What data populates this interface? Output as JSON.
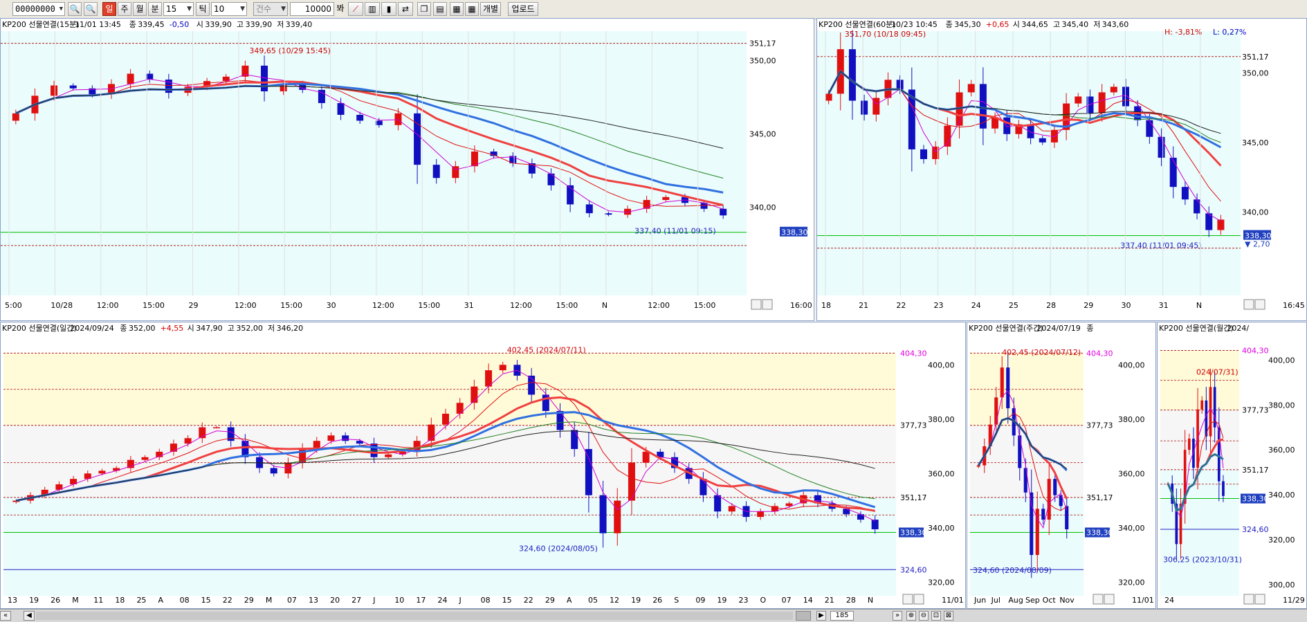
{
  "toolbar": {
    "code": "00000000",
    "buttons": [
      "일",
      "주",
      "월",
      "분"
    ],
    "active": "일",
    "interval": "15",
    "tick_label": "틱",
    "tick_value": "10",
    "count_label": "건수",
    "count_value": "10000",
    "bar_label": "봐",
    "individual": "개별",
    "upload": "업로드"
  },
  "panels": [
    {
      "id": "p15",
      "header": {
        "name": "KP200 선물연결(15분)",
        "date": "11/01 13:45",
        "close_label": "종",
        "close": "339,45",
        "change": "-0,50",
        "open_label": "시",
        "open": "339,90",
        "high_label": "고",
        "high": "339,90",
        "low_label": "저",
        "low": "339,40"
      },
      "right_labels": [
        "351,17",
        "350,00",
        "345,00",
        "340,00"
      ],
      "price_tag": "338,30",
      "time_end": "16:00",
      "annotations": [
        "349,65 (10/29 15:45)",
        "337,40 (11/01 09:15)"
      ],
      "x_labels": [
        "5:00",
        "10/28",
        "12:00",
        "15:00",
        "29",
        "12:00",
        "15:00",
        "30",
        "12:00",
        "15:00",
        "31",
        "12:00",
        "15:00",
        "N",
        "12:00",
        "15:00"
      ]
    },
    {
      "id": "p60",
      "header": {
        "name": "KP200 선물연결(60분)",
        "date": "10/23 10:45",
        "close_label": "종",
        "close": "345,30",
        "change": "+0,65",
        "open_label": "시",
        "open": "344,65",
        "high_label": "고",
        "high": "345,40",
        "low_label": "저",
        "low": "343,60"
      },
      "hl": {
        "h": "H: -3,81%",
        "l": "L: 0,27%"
      },
      "right_labels": [
        "351,17",
        "350,00",
        "345,00",
        "340,00"
      ],
      "price_tag": "338,30",
      "diff": "2,70",
      "time_end": "16:45",
      "annotations": [
        "351,70 (10/18 09:45)",
        "337,40 (11/01 09:45)"
      ],
      "x_labels": [
        "18",
        "21",
        "22",
        "23",
        "24",
        "25",
        "28",
        "29",
        "30",
        "31",
        "N"
      ]
    },
    {
      "id": "pday",
      "header": {
        "name": "KP200 선물연결(일간)",
        "date": "2024/09/24",
        "close_label": "종",
        "close": "352,00",
        "change": "+4,55",
        "open_label": "시",
        "open": "347,90",
        "high_label": "고",
        "high": "352,00",
        "low_label": "저",
        "low": "346,20"
      },
      "left_labels": [
        "404,30",
        "377,73",
        "351,17",
        "338,30",
        "324,60"
      ],
      "right_labels": [
        "400,00",
        "380,00",
        "360,00",
        "340,00",
        "320,00"
      ],
      "time_end": "11/01",
      "annotations": [
        "402,45 (2024/07/11)",
        "324,60 (2024/08/05)"
      ],
      "x_labels": [
        "13",
        "19",
        "26",
        "M",
        "11",
        "18",
        "25",
        "A",
        "08",
        "15",
        "22",
        "29",
        "M",
        "07",
        "13",
        "20",
        "27",
        "J",
        "10",
        "17",
        "24",
        "J",
        "08",
        "15",
        "22",
        "29",
        "A",
        "05",
        "12",
        "19",
        "26",
        "S",
        "09",
        "19",
        "23",
        "O",
        "07",
        "14",
        "21",
        "28",
        "N"
      ]
    },
    {
      "id": "pweek",
      "header": {
        "name": "KP200 선물연결(주간)",
        "date": "2024/07/19",
        "close_label": "종"
      },
      "left_labels": [
        "404,30",
        "377,73",
        "351,17",
        "338,30"
      ],
      "right_labels": [
        "400,00",
        "380,00",
        "360,00",
        "340,00",
        "320,00"
      ],
      "time_end": "11/01",
      "annotations": [
        "402,45 (2024/07/12)",
        "324,60 (2024/08/09)"
      ],
      "x_labels": [
        "Jun",
        "Jul",
        "Aug",
        "Sep",
        "Oct",
        "Nov"
      ]
    },
    {
      "id": "pmonth",
      "header": {
        "name": "KP200 선물연결(월간)",
        "date": "2024/"
      },
      "left_labels": [
        "404,30",
        "377,73",
        "351,17",
        "338,30",
        "324,60"
      ],
      "right_labels": [
        "400,00",
        "380,00",
        "360,00",
        "340,00",
        "320,00",
        "300,00"
      ],
      "time_end": "11/29",
      "annotations": [
        "024/07/31)",
        "306,25 (2023/10/31)"
      ],
      "x_labels": [
        "24"
      ]
    }
  ],
  "chart_data": [
    {
      "type": "candlestick",
      "title": "KP200 선물연결(15분)",
      "ylim": [
        334,
        352
      ],
      "reference_lines": {
        "351,17": 351.17,
        "338,30": 338.3
      },
      "series": [
        {
          "name": "KP200 선물연결(15분)",
          "close": [
            346.4,
            347.6,
            348.3,
            348.1,
            347.7,
            348.4,
            349.1,
            348.7,
            347.8,
            348.2,
            348.6,
            348.9,
            349.65,
            347.9,
            348.4,
            348.0,
            347.1,
            346.3,
            345.9,
            345.6,
            346.4,
            342.9,
            342.0,
            342.8,
            343.8,
            343.5,
            343.0,
            342.3,
            341.5,
            340.2,
            339.6,
            339.5,
            339.9,
            340.5,
            340.7,
            340.3,
            339.9,
            339.45
          ]
        }
      ]
    },
    {
      "type": "candlestick",
      "title": "KP200 선물연결(60분)",
      "ylim": [
        334,
        353
      ],
      "reference_lines": {
        "351,17": 351.17,
        "338,30": 338.3
      },
      "series": [
        {
          "name": "KP200 선물연결(60분)",
          "close": [
            348.5,
            351.7,
            348.0,
            347.0,
            348.2,
            349.5,
            348.8,
            344.5,
            343.8,
            344.7,
            346.2,
            348.6,
            349.2,
            346.0,
            346.8,
            345.6,
            346.3,
            345.3,
            345.0,
            345.9,
            347.8,
            348.3,
            347.1,
            348.6,
            349.0,
            347.6,
            346.6,
            345.4,
            343.9,
            341.8,
            340.9,
            339.9,
            338.7,
            339.45
          ]
        }
      ]
    },
    {
      "type": "candlestick",
      "title": "KP200 선물연결(일간)",
      "ylim": [
        315,
        410
      ],
      "reference_lines": {
        "404,30": 404.3,
        "377,73": 377.73,
        "351,17": 351.17,
        "338,30": 338.3,
        "324,60": 324.6
      },
      "series": [
        {
          "name": "KP200 선물연결(일간)",
          "close": [
            350,
            352,
            354,
            356,
            358,
            360,
            361,
            362,
            365,
            366,
            368,
            371,
            373,
            377,
            377,
            372,
            366,
            362,
            360,
            364,
            369,
            372,
            374,
            372,
            371,
            366,
            367,
            368,
            372,
            378,
            382,
            386,
            392,
            398,
            400,
            396,
            389,
            383,
            376,
            369,
            352,
            338,
            350,
            364,
            368,
            366,
            362,
            358,
            352,
            346,
            348,
            344,
            346,
            348,
            349,
            352,
            349,
            347,
            345,
            343,
            339.45
          ]
        }
      ]
    },
    {
      "type": "candlestick",
      "title": "KP200 선물연결(주간)",
      "ylim": [
        315,
        410
      ],
      "reference_lines": {
        "404,30": 404.3,
        "377,73": 377.73,
        "351,17": 351.17,
        "338,30": 338.3,
        "324,60": 324.6
      },
      "series": [
        {
          "name": "KP200 선물연결(주간)",
          "close": [
            363,
            370,
            378,
            388,
            399,
            384,
            374,
            362,
            353,
            330,
            347,
            343,
            358,
            352,
            348,
            339.45
          ]
        }
      ]
    },
    {
      "type": "candlestick",
      "title": "KP200 선물연결(월간)",
      "ylim": [
        295,
        410
      ],
      "reference_lines": {
        "404,30": 404.3,
        "377,73": 377.73,
        "351,17": 351.17,
        "338,30": 338.3,
        "324,60": 324.6
      },
      "series": [
        {
          "name": "KP200 선물연결(월간)",
          "close": [
            345,
            336,
            318,
            336,
            360,
            365,
            352,
            378,
            382,
            366,
            388,
            370,
            346,
            339.45
          ]
        }
      ]
    }
  ]
}
